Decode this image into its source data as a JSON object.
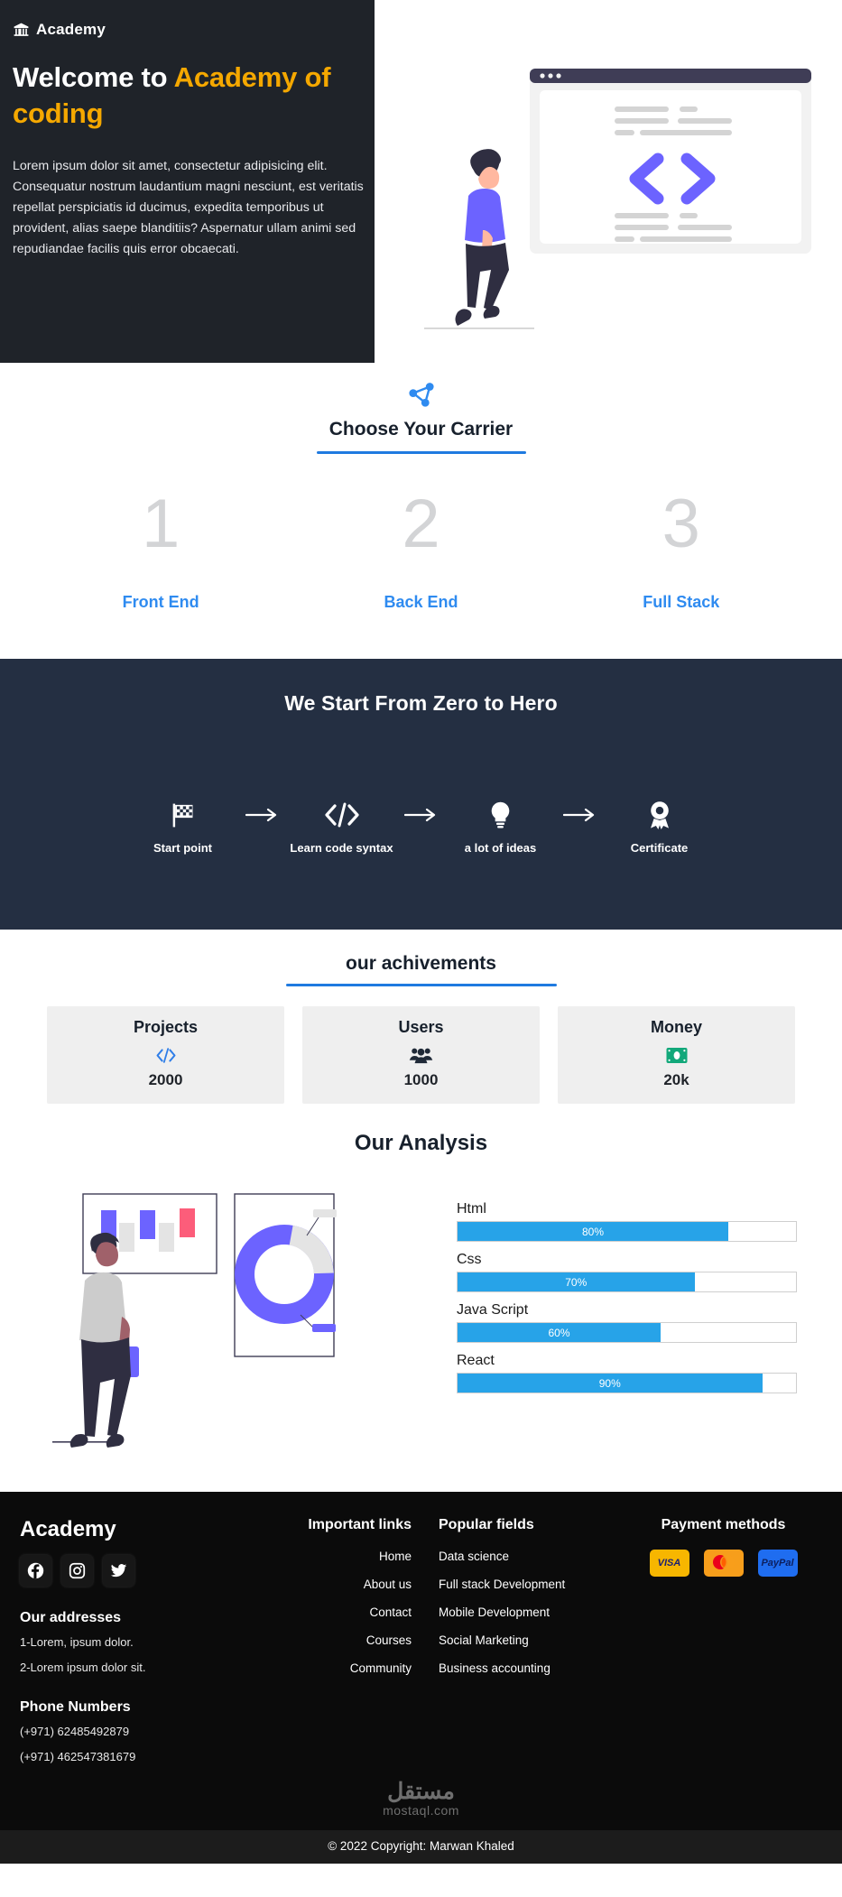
{
  "brand": {
    "name": "Academy",
    "icon": "bank-columns-icon"
  },
  "hero": {
    "title_plain": "Welcome to ",
    "title_accent": "Academy of coding",
    "paragraph": "Lorem ipsum dolor sit amet, consectetur adipisicing elit. Consequatur nostrum laudantium magni nesciunt, est veritatis repellat perspiciatis id ducimus, expedita temporibus ut provident, alias saepe blanditiis? Aspernatur ullam animi sed repudiandae facilis quis error obcaecati.",
    "illustration": "developer-walking-past-code-window"
  },
  "carrier": {
    "icon": "share-network-icon",
    "title": "Choose Your Carrier",
    "options": [
      {
        "number": "1",
        "label": "Front End"
      },
      {
        "number": "2",
        "label": "Back End"
      },
      {
        "number": "3",
        "label": "Full Stack"
      }
    ]
  },
  "journey": {
    "title": "We Start From Zero to Hero",
    "arrow": "→",
    "steps": [
      {
        "icon": "checkered-flag-icon",
        "label": "Start point"
      },
      {
        "icon": "code-brackets-icon",
        "label": "Learn code syntax"
      },
      {
        "icon": "lightbulb-icon",
        "label": "a lot of ideas"
      },
      {
        "icon": "award-ribbon-icon",
        "label": "Certificate"
      }
    ]
  },
  "achievements": {
    "title": "our achivements",
    "cards": [
      {
        "title": "Projects",
        "icon": "code-brackets-icon",
        "value": "2000",
        "color": "#2f7ee8"
      },
      {
        "title": "Users",
        "icon": "users-group-icon",
        "value": "1000",
        "color": "#1f2937"
      },
      {
        "title": "Money",
        "icon": "money-bill-icon",
        "value": "20k",
        "color": "#12a87a"
      }
    ]
  },
  "analysis": {
    "title": "Our Analysis",
    "illustration": "person-viewing-charts",
    "chart_data": {
      "type": "bar",
      "title": "Our Analysis",
      "categories": [
        "Html",
        "Css",
        "Java Script",
        "React"
      ],
      "values": [
        80,
        70,
        60,
        90
      ],
      "value_labels": [
        "80%",
        "70%",
        "60%",
        "90%"
      ],
      "xlabel": "",
      "ylabel": "",
      "ylim": [
        0,
        100
      ],
      "orientation": "horizontal",
      "grid": false,
      "legend": "none",
      "bar_color": "#27a3e8",
      "track_color": "#ffffff"
    }
  },
  "footer": {
    "logo": "Academy",
    "socials": [
      {
        "name": "facebook-icon"
      },
      {
        "name": "instagram-icon"
      },
      {
        "name": "twitter-icon"
      }
    ],
    "addresses_head": "Our addresses",
    "addresses": [
      "1-Lorem, ipsum dolor.",
      "2-Lorem ipsum dolor sit."
    ],
    "phones_head": "Phone Numbers",
    "phones": [
      "(+971) 62485492879",
      "(+971) 462547381679"
    ],
    "links_head": "Important links",
    "links": [
      "Home",
      "About us",
      "Contact",
      "Courses",
      "Community"
    ],
    "fields_head": "Popular fields",
    "fields": [
      "Data science",
      "Full stack Development",
      "Mobile Development",
      "Social Marketing",
      "Business accounting"
    ],
    "payment_head": "Payment methods",
    "payments": [
      {
        "name": "visa-logo",
        "label": "VISA"
      },
      {
        "name": "mastercard-logo",
        "label": "mastercard"
      },
      {
        "name": "paypal-logo",
        "label": "PayPal"
      }
    ]
  },
  "watermark": {
    "arabic": "مستقل",
    "latin": "mostaql.com"
  },
  "copyright": "© 2022 Copyright: Marwan Khaled"
}
